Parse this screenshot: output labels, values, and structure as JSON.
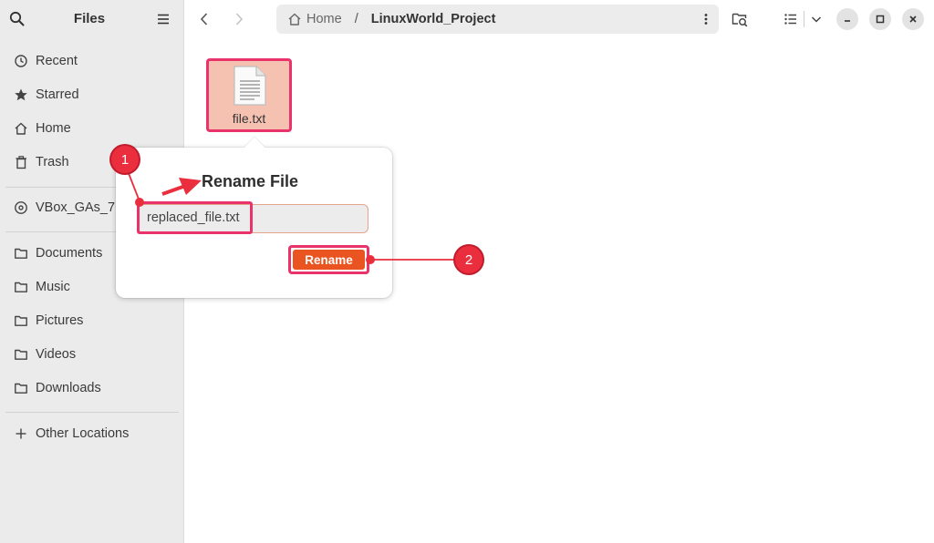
{
  "sidebar": {
    "title": "Files",
    "places": [
      {
        "label": "Recent",
        "icon": "clock-icon"
      },
      {
        "label": "Starred",
        "icon": "star-icon"
      },
      {
        "label": "Home",
        "icon": "home-icon"
      },
      {
        "label": "Trash",
        "icon": "trash-icon"
      }
    ],
    "devices": [
      {
        "label": "VBox_GAs_7.0.",
        "icon": "disc-icon"
      }
    ],
    "bookmarks": [
      {
        "label": "Documents",
        "icon": "folder-icon"
      },
      {
        "label": "Music",
        "icon": "folder-icon"
      },
      {
        "label": "Pictures",
        "icon": "folder-icon"
      },
      {
        "label": "Videos",
        "icon": "folder-icon"
      },
      {
        "label": "Downloads",
        "icon": "folder-icon"
      }
    ],
    "other": {
      "label": "Other Locations",
      "icon": "plus-icon"
    }
  },
  "pathbar": {
    "home_label": "Home",
    "separator": "/",
    "current": "LinuxWorld_Project"
  },
  "file": {
    "name": "file.txt",
    "icon": "text-document-icon"
  },
  "rename_popover": {
    "title": "Rename File",
    "entry_value": "replaced_file.txt",
    "button_label": "Rename"
  },
  "annotations": {
    "step1": "1",
    "step2": "2"
  },
  "colors": {
    "accent": "#e95420",
    "highlight": "#e8336b",
    "badge": "#ea2e3e",
    "sidebar_bg": "#ebebeb"
  }
}
